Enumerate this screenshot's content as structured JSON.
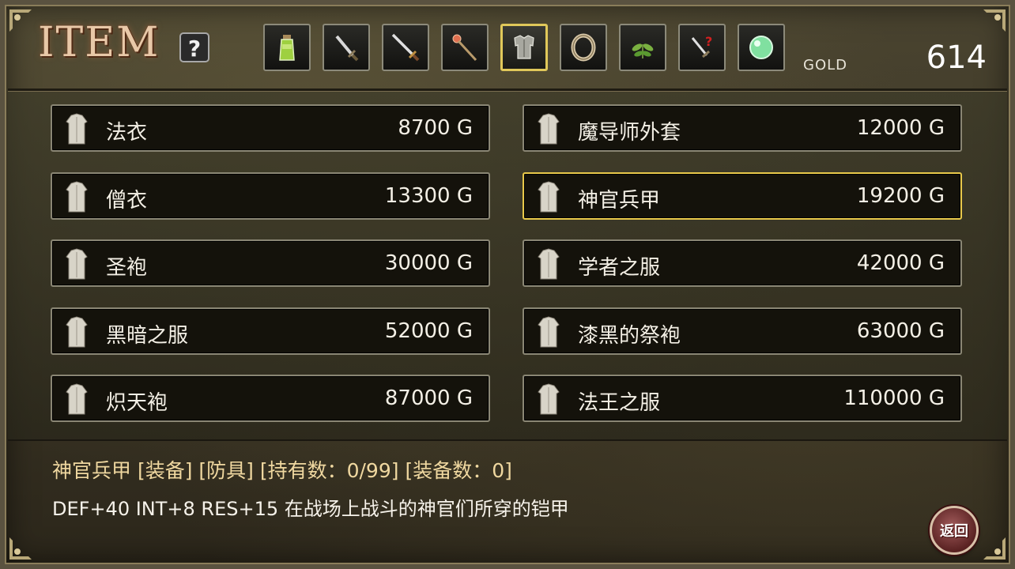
{
  "header": {
    "title": "ITEM",
    "help_label": "?",
    "tabs": [
      {
        "icon": "potion-icon",
        "selected": false
      },
      {
        "icon": "short-sword-icon",
        "selected": false
      },
      {
        "icon": "long-sword-icon",
        "selected": false
      },
      {
        "icon": "staff-icon",
        "selected": false
      },
      {
        "icon": "armor-icon",
        "selected": true
      },
      {
        "icon": "ring-icon",
        "selected": false
      },
      {
        "icon": "herb-icon",
        "selected": false
      },
      {
        "icon": "mystery-sword-icon",
        "selected": false
      },
      {
        "icon": "gem-orb-icon",
        "selected": false
      }
    ],
    "gold_label": "GOLD",
    "gold_value": "614"
  },
  "items": [
    {
      "name": "法衣",
      "price": "8700 G",
      "selected": false
    },
    {
      "name": "魔导师外套",
      "price": "12000 G",
      "selected": false
    },
    {
      "name": "僧衣",
      "price": "13300 G",
      "selected": false
    },
    {
      "name": "神官兵甲",
      "price": "19200 G",
      "selected": true
    },
    {
      "name": "圣袍",
      "price": "30000 G",
      "selected": false
    },
    {
      "name": "学者之服",
      "price": "42000 G",
      "selected": false
    },
    {
      "name": "黑暗之服",
      "price": "52000 G",
      "selected": false
    },
    {
      "name": "漆黑的祭袍",
      "price": "63000 G",
      "selected": false
    },
    {
      "name": "炽天袍",
      "price": "87000 G",
      "selected": false
    },
    {
      "name": "法王之服",
      "price": "110000 G",
      "selected": false
    }
  ],
  "description": {
    "title": "神官兵甲  [装备] [防具] [持有数：0/99] [装备数：0]",
    "text": "DEF+40 INT+8 RES+15 在战场上战斗的神官们所穿的铠甲"
  },
  "back_button": {
    "label": "返回"
  },
  "colors": {
    "selected_border": "#e8c84a",
    "item_bg": "#14120b",
    "title_color": "#e8c8a8"
  }
}
